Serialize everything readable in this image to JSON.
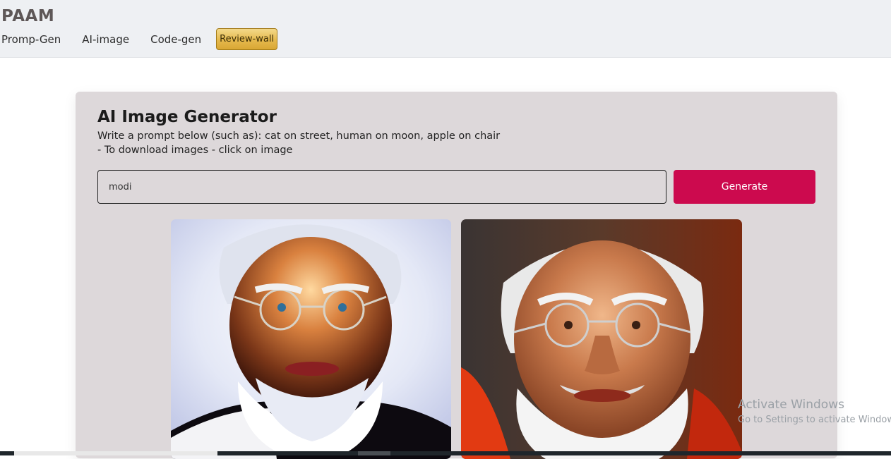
{
  "app": {
    "brand": "PAAM"
  },
  "nav": {
    "items": [
      {
        "label": "Promp-Gen"
      },
      {
        "label": "AI-image"
      },
      {
        "label": "Code-gen"
      },
      {
        "label": "Review-wall"
      }
    ]
  },
  "generator": {
    "title": "AI Image Generator",
    "description_line1": "Write a prompt below (such as): cat on street, human on moon, apple on chair",
    "description_line2": "- To download images - click on image",
    "prompt_value": "modi",
    "generate_label": "Generate",
    "accent_color": "#cc0a4e"
  },
  "results": {
    "images": [
      {
        "icon": "generated-portrait-image"
      },
      {
        "icon": "generated-portrait-image"
      }
    ]
  },
  "watermark": {
    "title": "Activate Windows",
    "subtitle": "Go to Settings to activate Windows."
  }
}
